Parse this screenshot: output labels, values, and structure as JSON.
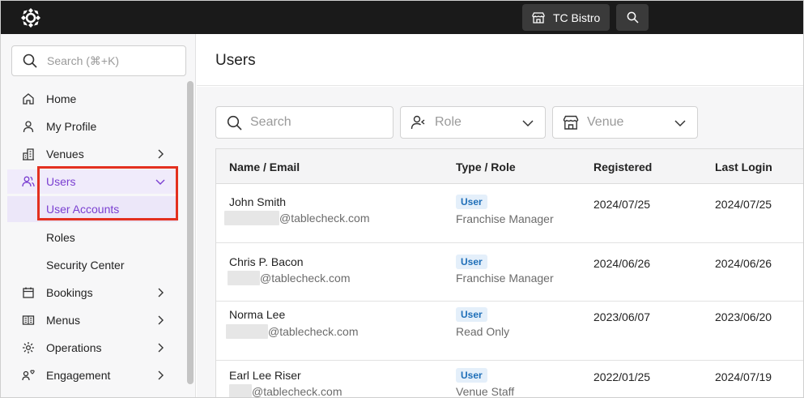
{
  "topbar": {
    "venue_label": "TC Bistro",
    "venue_icon": "store-icon",
    "search_icon": "search-icon"
  },
  "sidebar": {
    "search_placeholder": "Search (⌘+K)",
    "items": [
      {
        "label": "Home",
        "icon": "home-icon",
        "chevron": false
      },
      {
        "label": "My Profile",
        "icon": "user-icon",
        "chevron": false
      },
      {
        "label": "Venues",
        "icon": "building-icon",
        "chevron": true
      },
      {
        "label": "Users",
        "icon": "users-icon",
        "chevron": true,
        "expanded": true
      },
      {
        "label": "Bookings",
        "icon": "calendar-icon",
        "chevron": true
      },
      {
        "label": "Menus",
        "icon": "menu-book-icon",
        "chevron": true
      },
      {
        "label": "Operations",
        "icon": "gear-icon",
        "chevron": true
      },
      {
        "label": "Engagement",
        "icon": "engagement-icon",
        "chevron": true
      }
    ],
    "subitems": [
      {
        "label": "User Accounts",
        "active": true
      },
      {
        "label": "Roles",
        "active": false
      },
      {
        "label": "Security Center",
        "active": false
      }
    ]
  },
  "main": {
    "title": "Users",
    "filters": {
      "search_placeholder": "Search",
      "role_placeholder": "Role",
      "venue_placeholder": "Venue"
    },
    "table": {
      "headers": [
        "Name / Email",
        "Type / Role",
        "Registered",
        "Last Login"
      ],
      "rows": [
        {
          "name": "John Smith",
          "email": "@tablecheck.com",
          "type": "User",
          "role": "Franchise Manager",
          "registered": "2024/07/25",
          "last_login": "2024/07/25"
        },
        {
          "name": "Chris P. Bacon",
          "email": "@tablecheck.com",
          "type": "User",
          "role": "Franchise Manager",
          "registered": "2024/06/26",
          "last_login": "2024/06/26"
        },
        {
          "name": "Norma Lee",
          "email": "@tablecheck.com",
          "type": "User",
          "role": "Read Only",
          "registered": "2023/06/07",
          "last_login": "2023/06/20"
        },
        {
          "name": "Earl Lee Riser",
          "email": "@tablecheck.com",
          "type": "User",
          "role": "Venue Staff",
          "registered": "2022/01/25",
          "last_login": "2024/07/19"
        }
      ]
    }
  },
  "colors": {
    "accent": "#7a3fd1",
    "highlight": "#e3301f",
    "badge_bg": "#e4effa",
    "badge_text": "#1f6fb8",
    "topbar": "#1a1a1a"
  }
}
